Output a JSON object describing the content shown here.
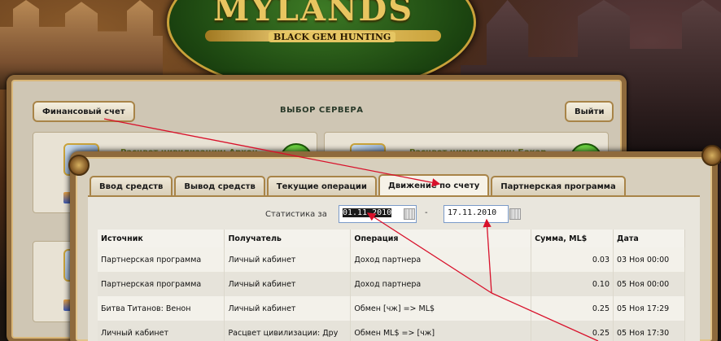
{
  "logo": {
    "title": "MYLANDS",
    "subtitle": "BLACK GEM HUNTING"
  },
  "back_panel": {
    "financial_button": "Финансовый счет",
    "server_select_title": "ВЫБОР СЕРВЕРА",
    "exit_button": "Выйти",
    "servers": [
      {
        "name": "Расцвет цивилизации: Архон"
      },
      {
        "name": "Расцвет цивилизации: Бакар"
      }
    ]
  },
  "tabs": [
    {
      "label": "Ввод средств",
      "active": false
    },
    {
      "label": "Вывод средств",
      "active": false
    },
    {
      "label": "Текущие операции",
      "active": false
    },
    {
      "label": "Движение по счету",
      "active": true
    },
    {
      "label": "Партнерская программа",
      "active": false
    }
  ],
  "stats": {
    "label": "Статистика за",
    "date_from": "01.11.2010",
    "separator": "-",
    "date_to": "17.11.2010"
  },
  "table": {
    "headers": {
      "source": "Источник",
      "recipient": "Получатель",
      "operation": "Операция",
      "amount": "Сумма, ML$",
      "date": "Дата"
    },
    "rows": [
      {
        "source": "Партнерская программа",
        "recipient": "Личный кабинет",
        "operation": "Доход партнера",
        "amount": "0.03",
        "date": "03 Ноя 00:00"
      },
      {
        "source": "Партнерская программа",
        "recipient": "Личный кабинет",
        "operation": "Доход партнера",
        "amount": "0.10",
        "date": "05 Ноя 00:00"
      },
      {
        "source": "Битва Титанов: Венон",
        "recipient": "Личный кабинет",
        "operation": "Обмен [чж] => ML$",
        "amount": "0.25",
        "date": "05 Ноя 17:29"
      },
      {
        "source": "Личный кабинет",
        "recipient": "Расцвет цивилизации: Дру",
        "operation": "Обмен ML$ => [чж]",
        "amount": "0.25",
        "date": "05 Ноя 17:30"
      }
    ]
  },
  "colors": {
    "frame": "#8e6a3c",
    "annotation_arrow": "#d8102a",
    "server_name": "#7a8a2a"
  }
}
